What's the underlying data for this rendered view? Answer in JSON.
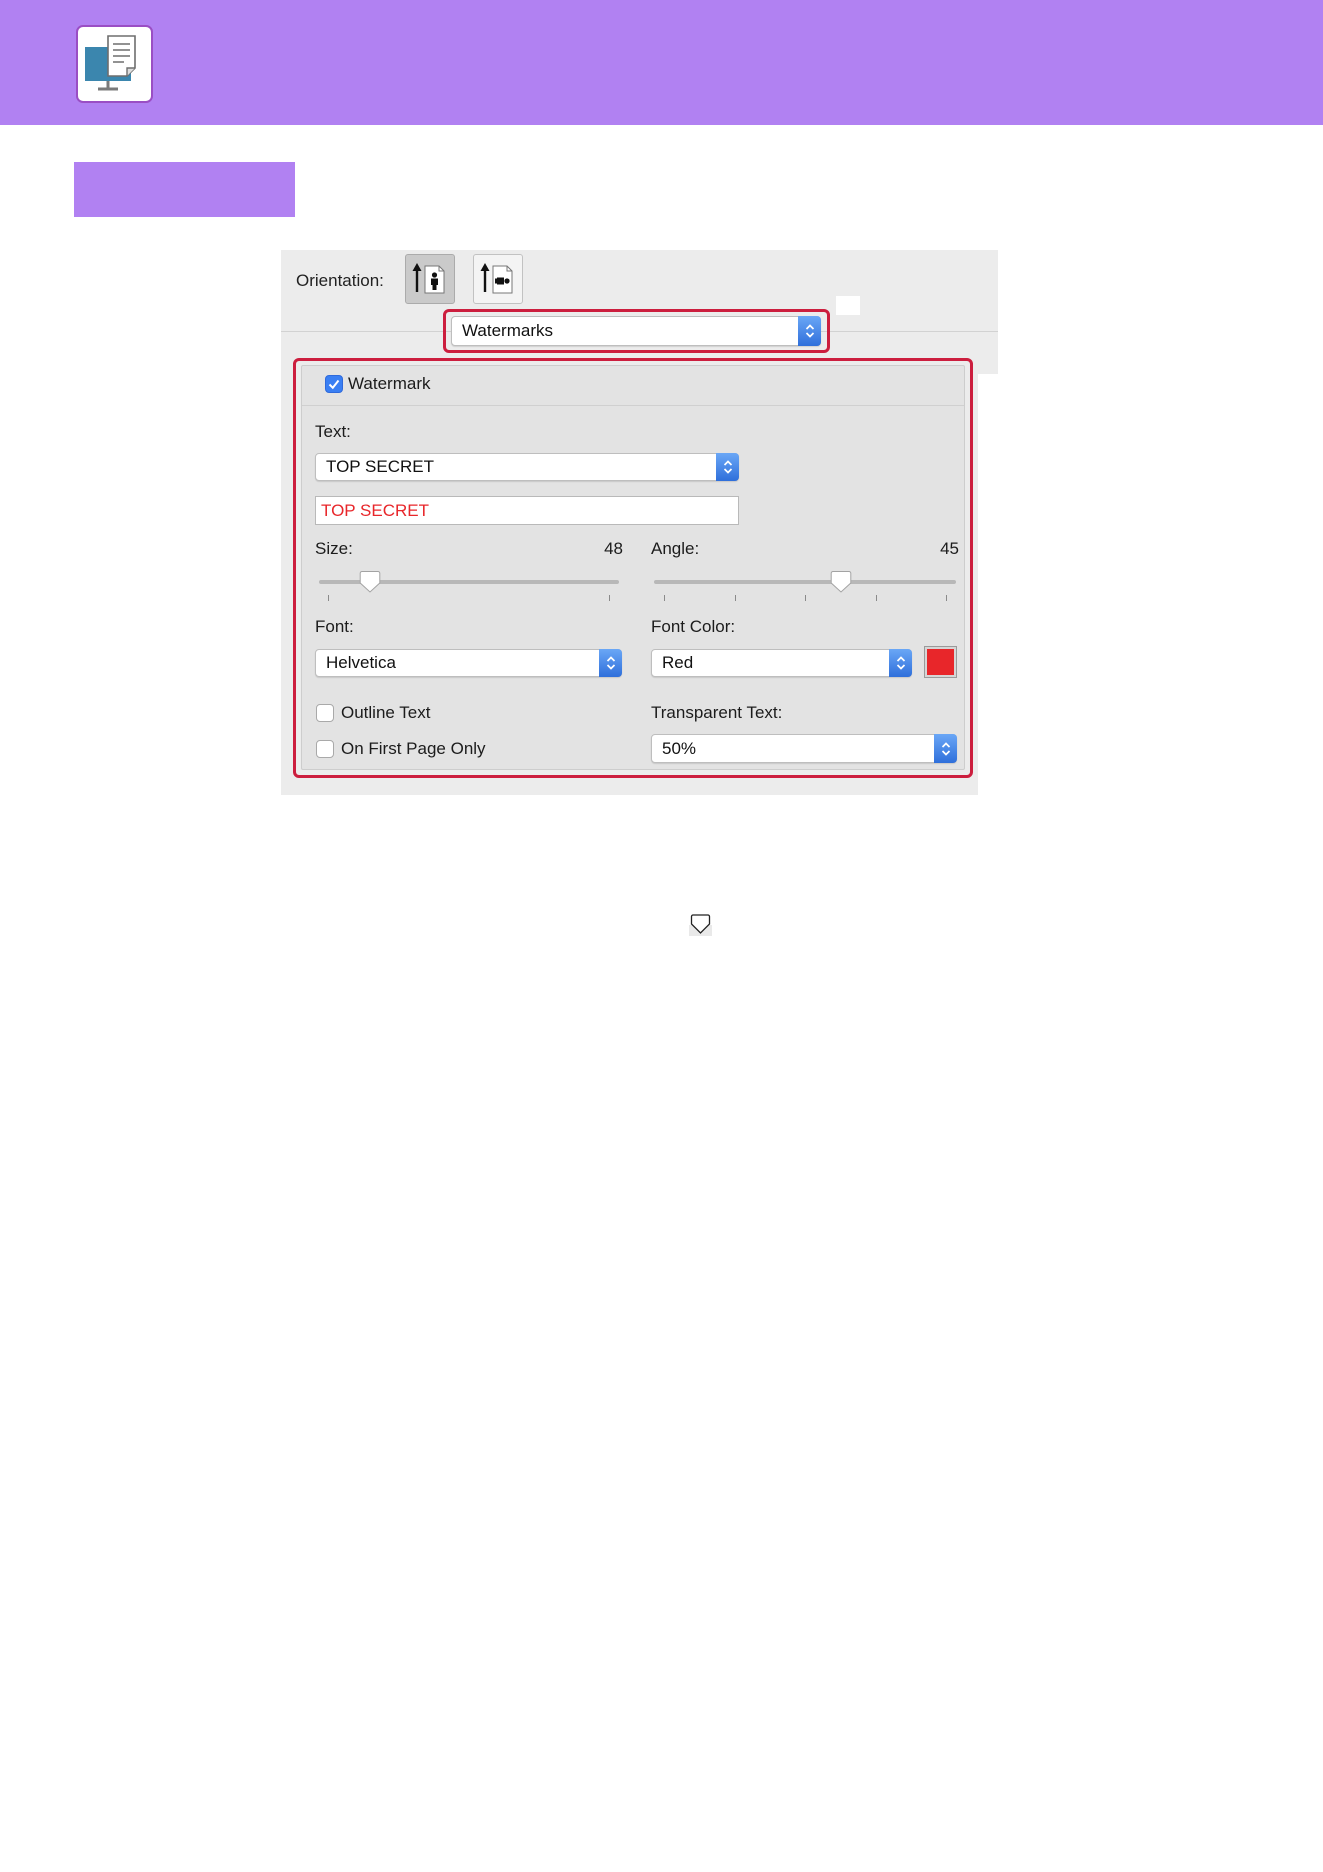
{
  "header": {
    "icon": "computer-document-icon",
    "band_color": "#B181F2"
  },
  "dialog": {
    "orientation": {
      "label": "Orientation:",
      "options": [
        {
          "icon": "portrait-orientation-icon",
          "selected": true
        },
        {
          "icon": "landscape-orientation-icon",
          "selected": false
        }
      ]
    },
    "panel_menu": {
      "value": "Watermarks"
    },
    "watermark": {
      "enable": {
        "label": "Watermark",
        "checked": true
      },
      "text": {
        "label": "Text:",
        "preset": "TOP SECRET",
        "custom": "TOP SECRET",
        "color": "#E8262A"
      },
      "size": {
        "label": "Size:",
        "value": "48",
        "slider_level": 0.17
      },
      "angle": {
        "label": "Angle:",
        "value": "45",
        "slider_level": 0.62
      },
      "font": {
        "label": "Font:",
        "value": "Helvetica"
      },
      "font_color": {
        "label": "Font Color:",
        "value": "Red",
        "swatch": "#E8262A"
      },
      "outline_text": {
        "label": "Outline Text",
        "checked": false
      },
      "first_page_only": {
        "label": "On First Page Only",
        "checked": false
      },
      "transparent_text": {
        "label": "Transparent Text:",
        "value": "50%"
      }
    }
  },
  "annotation": {
    "highlight_color": "#CC1E3E"
  },
  "footer": {
    "icon": "slider-thumb-icon"
  }
}
